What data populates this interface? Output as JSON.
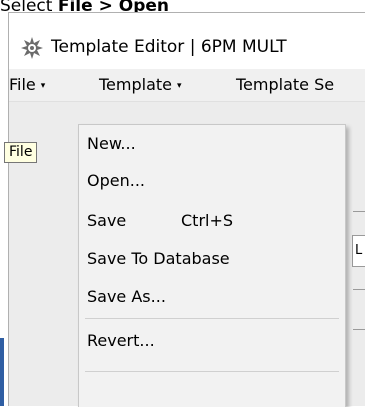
{
  "caption": {
    "prefix": "Select ",
    "bold": "File > Open"
  },
  "window": {
    "title": "Template Editor | 6PM MULT",
    "icon": "gear-flower-icon"
  },
  "menubar": {
    "items": [
      {
        "label": "File",
        "arrow": "▾"
      },
      {
        "label": "Template",
        "arrow": "▾"
      },
      {
        "label": "Template Se"
      }
    ]
  },
  "tooltip": {
    "text": "File"
  },
  "background": {
    "field_text": "L"
  },
  "file_menu": {
    "items": [
      {
        "label": "New..."
      },
      {
        "label": "Open..."
      },
      {
        "label": "Save",
        "shortcut": "Ctrl+S"
      },
      {
        "label": "Save To Database"
      },
      {
        "label": "Save As..."
      },
      {
        "label": "Revert..."
      }
    ]
  },
  "colors": {
    "menubar": "#f0f0f0",
    "menu_bg": "#f2f2f2",
    "tooltip_bg": "#ffffe1",
    "accent": "#3a76c9"
  }
}
